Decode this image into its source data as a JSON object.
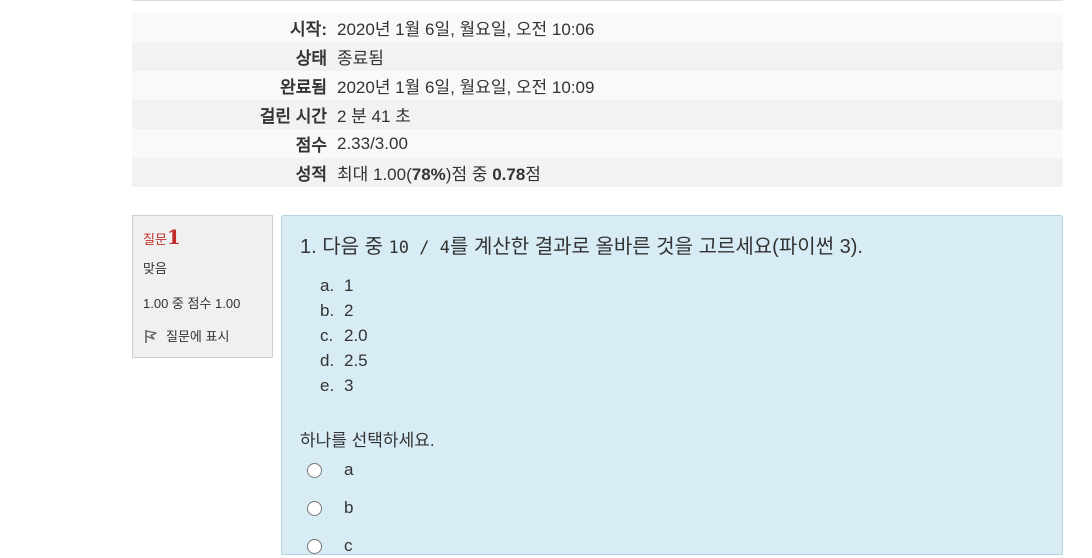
{
  "summary": {
    "rows": [
      {
        "label": "시작:",
        "value": "2020년 1월 6일, 월요일, 오전 10:06"
      },
      {
        "label": "상태",
        "value": "종료됨"
      },
      {
        "label": "완료됨",
        "value": "2020년 1월 6일, 월요일, 오전 10:09"
      },
      {
        "label": "걸린 시간",
        "value": "2 분 41 초"
      },
      {
        "label": "점수",
        "value": "2.33/3.00"
      }
    ],
    "grade": {
      "label": "성적",
      "prefix": "최대 1.00(",
      "percent": "78%",
      "middle": ")점 중 ",
      "score": "0.78",
      "suffix": "점"
    }
  },
  "question_info": {
    "label": "질문",
    "number": "1",
    "state": "맞음",
    "grade": "1.00 중 점수 1.00",
    "flag_label": "질문에 표시",
    "flag_icon": "flag-icon"
  },
  "question": {
    "text_prefix": "1. 다음 중 ",
    "code": "10 / 4",
    "text_suffix": "를 계산한 결과로 올바른 것을 고르세요(파이썬 3).",
    "choices": [
      {
        "letter": "a.",
        "text": "1"
      },
      {
        "letter": "b.",
        "text": "2"
      },
      {
        "letter": "c.",
        "text": "2.0"
      },
      {
        "letter": "d.",
        "text": "2.5"
      },
      {
        "letter": "e.",
        "text": "3"
      }
    ],
    "prompt": "하나를 선택하세요.",
    "options": [
      "a",
      "b",
      "c"
    ]
  },
  "colors": {
    "content_bg": "#d8ecf5",
    "info_bg": "#f0f0f0",
    "question_number": "#c12e2a"
  }
}
